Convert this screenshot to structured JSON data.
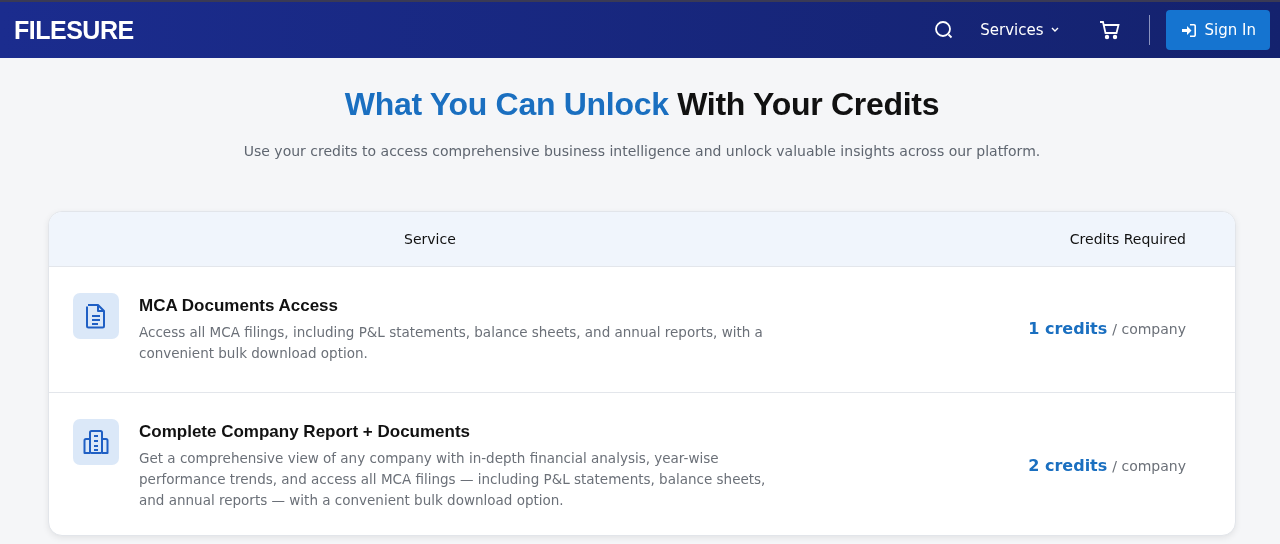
{
  "header": {
    "logo": "FILESURE",
    "nav": [
      {
        "kind": "search"
      },
      {
        "kind": "menu",
        "label": "Services"
      },
      {
        "kind": "cart"
      }
    ],
    "sign_in": "Sign In"
  },
  "hero": {
    "title_highlight": "What You Can Unlock",
    "title_rest": "With Your Credits",
    "subtitle": "Use your credits to access comprehensive business intelligence and unlock valuable insights across our platform."
  },
  "table": {
    "columns": [
      "Service",
      "Credits Required"
    ],
    "rows": [
      {
        "kind": "document",
        "title": "MCA Documents Access",
        "description": "Access all MCA filings, including P&L statements, balance sheets, and annual reports, with a convenient bulk download option.",
        "credits": "1 credits",
        "unit": "/ company"
      },
      {
        "kind": "building",
        "title": "Complete Company Report + Documents",
        "description": "Get a comprehensive view of any company with in-depth financial analysis, year-wise performance trends, and access all MCA filings — including P&L statements, balance sheets, and annual reports — with a convenient bulk download option.",
        "credits": "2 credits",
        "unit": "/ company"
      }
    ]
  }
}
